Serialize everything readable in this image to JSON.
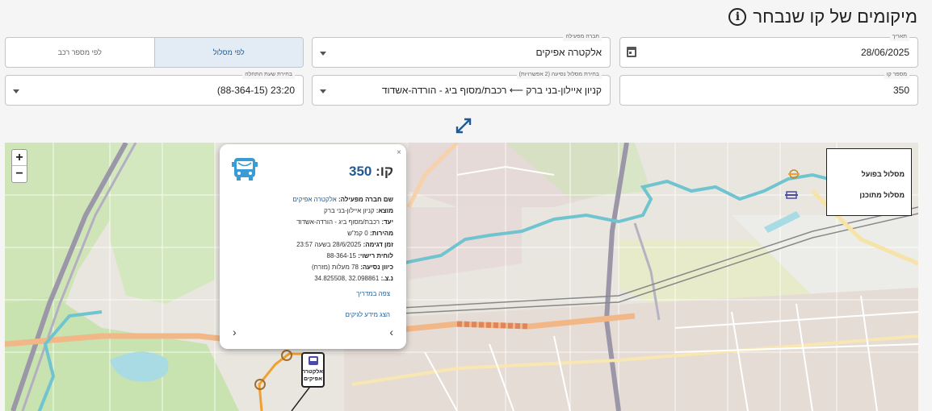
{
  "header": {
    "title": "מיקומים של קו שנבחר"
  },
  "filters": {
    "date": {
      "label": "תאריך",
      "value": "28/06/2025"
    },
    "operator": {
      "label": "חברה מפעילה",
      "value": "אלקטרה אפיקים"
    },
    "mode_toggle": {
      "by_route": "לפי מסלול",
      "by_vehicle": "לפי מספר רכב"
    },
    "line_number": {
      "label": "מספר קו",
      "value": "350"
    },
    "route": {
      "label": "בחירת מסלול נסיעה (2 אפשרויות)",
      "value": "קניון איילון-בני ברק ⟵ רכבת/מסוף ביג - הורדה-אשדוד"
    },
    "start_time": {
      "label": "בחירת שעת התחלה",
      "value": "23:20 (88-364-15)"
    }
  },
  "map": {
    "zoom_in": "+",
    "zoom_out": "−",
    "legend": {
      "actual": "מסלול בפועל",
      "planned": "מסלול מתוכנן"
    },
    "popup": {
      "close": "×",
      "line_label": "קו:",
      "line_value": "350",
      "operator_label": "שם חברה מפעילה:",
      "operator_value": "אלקטרה אפיקים",
      "origin_label": "מוצא:",
      "origin_value": "קניון איילון-בני ברק",
      "destination_label": "יעד:",
      "destination_value": "רכבת/מסוף ביג - הורדה-אשדוד",
      "speed_label": "מהירות:",
      "speed_value": "0 קמ\"ש",
      "sample_time_label": "זמן דגימה:",
      "sample_time_value": "28/6/2025 בשעה 23:57",
      "plate_label": "לוחית רישוי:",
      "plate_value": "88-364-15",
      "direction_label": "כיוון נסיעה:",
      "direction_value": "78 מעלות (מזרח)",
      "coords_label": "נ.צ.:",
      "coords_value": "32.098861 ,34.825508",
      "view_guide_link": "צפה במדריך",
      "lawyer_info_link": "הצג מידע לגיקים",
      "prev": "‹",
      "next": "›"
    },
    "bus_marker_text": "אלקטרה אפיקים",
    "colors": {
      "actual_route": "#f0a030",
      "planned_route": "#4a4aa8",
      "accent": "#1f5a94"
    }
  }
}
